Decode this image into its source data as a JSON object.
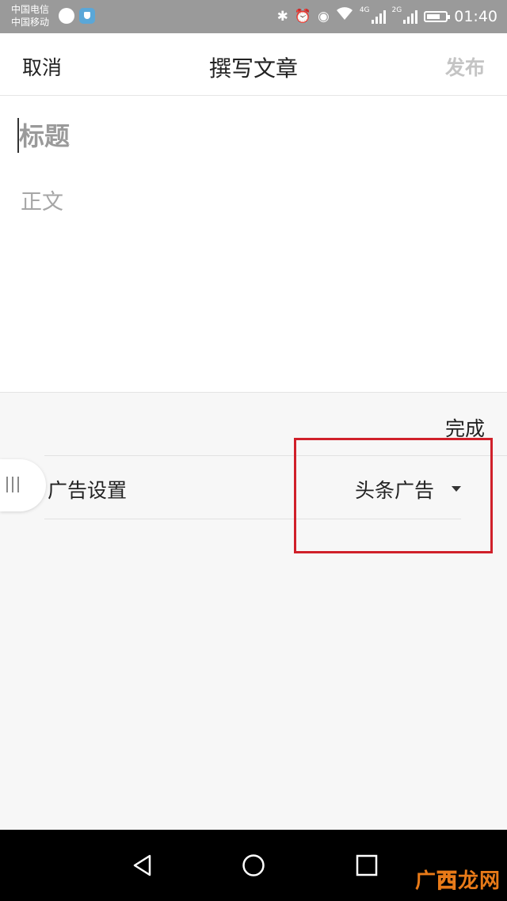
{
  "status_bar": {
    "carrier_1": "中国电信",
    "carrier_2": "中国移动",
    "network_1": "4G",
    "network_2": "2G",
    "time": "01:40",
    "icons": [
      "bluetooth-icon",
      "alarm-icon",
      "eye-icon",
      "wifi-icon",
      "signal-icon",
      "battery-icon"
    ]
  },
  "header": {
    "cancel": "取消",
    "title": "撰写文章",
    "publish": "发布"
  },
  "editor": {
    "title_placeholder": "标题",
    "body_placeholder": "正文"
  },
  "panel": {
    "done": "完成",
    "ad_setting_label": "广告设置",
    "ad_setting_value": "头条广告"
  },
  "watermark": {
    "part_1": "广",
    "part_2": "西",
    "part_3": "龙网"
  },
  "colors": {
    "status_bar": "#9a9a9a",
    "highlight": "#d0202a",
    "publish_disabled": "#c4c4c4",
    "panel_bg": "#f7f7f7"
  }
}
